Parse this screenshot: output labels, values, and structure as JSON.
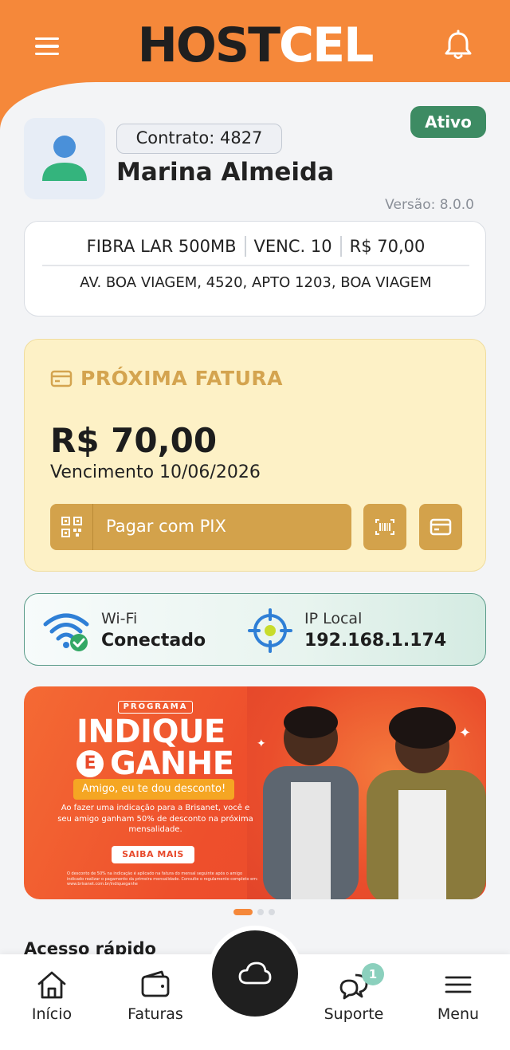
{
  "header": {
    "brand_part1": "HOST",
    "brand_part2": "CEL",
    "menu_icon": "hamburger-icon",
    "bell_icon": "bell-icon",
    "color": "#f5883a"
  },
  "profile": {
    "contract_label": "Contrato: 4827",
    "name": "Marina Almeida",
    "status": "Ativo",
    "status_color": "#3d8b63",
    "version": "Versão: 8.0.0",
    "avatar_icon": "user-icon"
  },
  "plan": {
    "name": "FIBRA LAR 500MB",
    "due_day": "VENC. 10",
    "price": "R$ 70,00",
    "address": "AV. BOA VIAGEM, 4520, APTO 1203, BOA VIAGEM"
  },
  "invoice": {
    "title": "PRÓXIMA FATURA",
    "amount": "R$ 70,00",
    "due": "Vencimento 10/06/2026",
    "pix_label": "Pagar com PIX",
    "pix_icon": "qr-code-icon",
    "barcode_icon": "barcode-icon",
    "card_icon": "credit-card-icon",
    "accent": "#d3a24b"
  },
  "network": {
    "wifi_label": "Wi-Fi",
    "wifi_status": "Conectado",
    "ip_label": "IP Local",
    "ip_value": "192.168.1.174"
  },
  "banner": {
    "program": "PROGRAMA",
    "title1": "INDIQUE",
    "e_letter": "E",
    "title2": "GANHE",
    "subtitle": "Amigo, eu te dou desconto!",
    "body": "Ao fazer uma indicação para a Brisanet, você e seu amigo ganham 50% de desconto na próxima mensalidade.",
    "cta": "SAIBA MAIS",
    "fine_print": "O desconto de 50% na indicação é aplicado na fatura do mensal seguinte após o amigo indicado realizar o pagamento da primeira mensalidade. Consulte o regulamento completo em: www.brisanet.com.br/indiqueganhe",
    "carousel_active": 0,
    "carousel_count": 3
  },
  "quick_access": {
    "title": "Acesso rápido"
  },
  "bottom_nav": {
    "items": [
      {
        "label": "Início",
        "icon": "home-icon"
      },
      {
        "label": "Faturas",
        "icon": "wallet-icon"
      },
      {
        "label": "Suporte",
        "icon": "chat-icon",
        "badge": "1"
      },
      {
        "label": "Menu",
        "icon": "menu-icon"
      }
    ],
    "center_icon": "cloud-icon"
  }
}
